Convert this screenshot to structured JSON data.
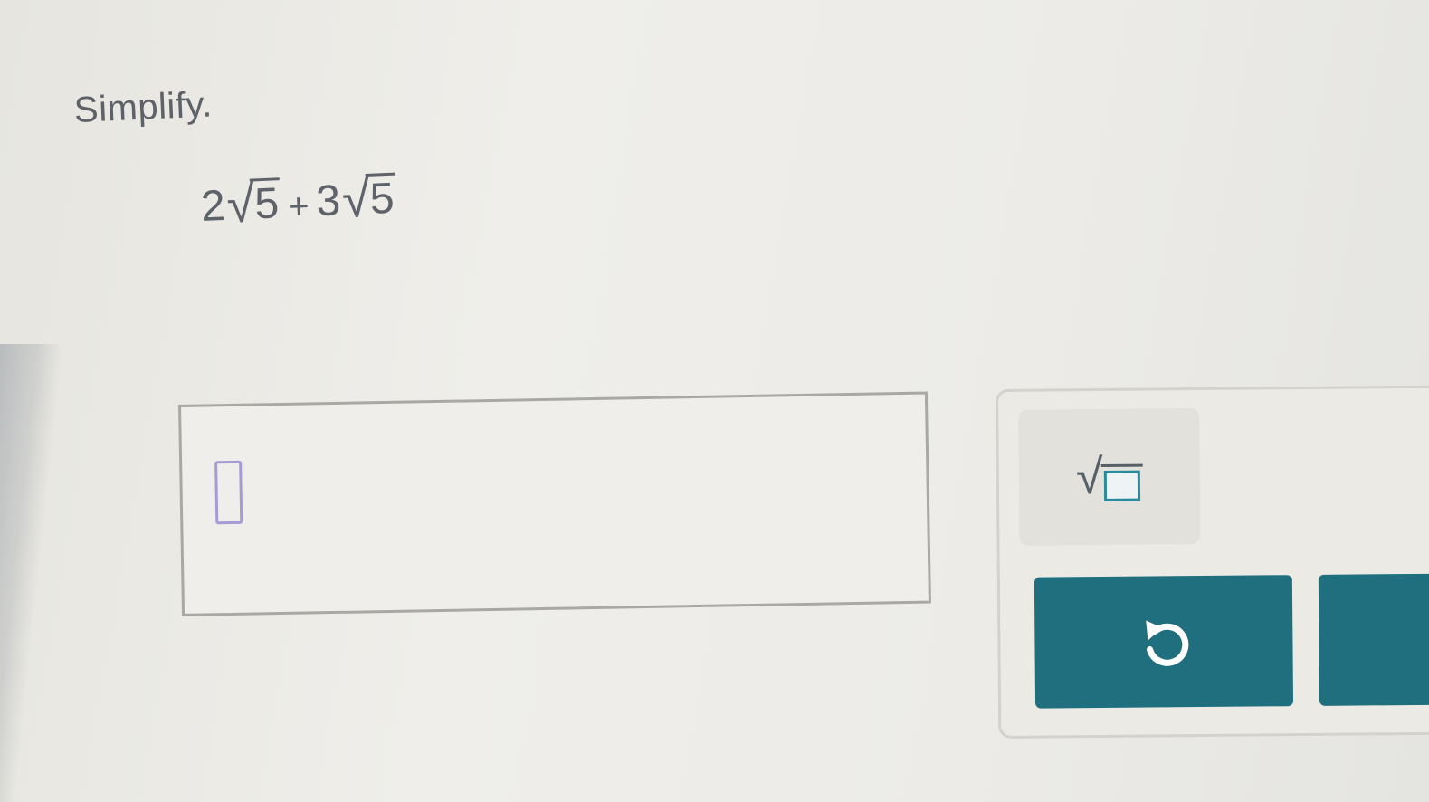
{
  "question": {
    "prompt": "Simplify.",
    "expression": {
      "term1_coef": "2",
      "term1_radicand": "5",
      "operator": "+",
      "term2_coef": "3",
      "term2_radicand": "5"
    }
  },
  "answer_input": {
    "value": ""
  },
  "keypad": {
    "sqrt_key_icon": "square-root-template-icon",
    "undo_icon": "undo-icon",
    "button_color": "#1f6f7f",
    "slot_color": "#2b8a9c"
  }
}
